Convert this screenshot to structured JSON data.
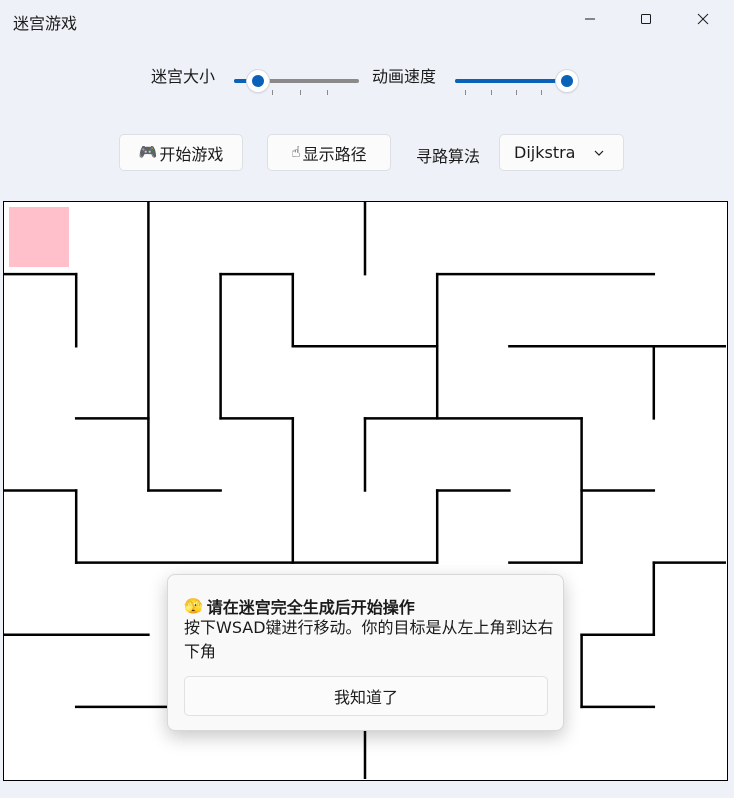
{
  "window": {
    "title": "迷宫游戏",
    "minimize_icon": "minimize-icon",
    "maximize_icon": "maximize-icon",
    "close_icon": "close-icon"
  },
  "controls": {
    "size_label": "迷宫大小",
    "size_value": 0.19,
    "speed_label": "动画速度",
    "speed_value": 1.0,
    "start_button": "开始游戏",
    "start_icon": "🎮",
    "path_button": "显示路径",
    "path_icon": "☝",
    "algo_label": "寻路算法",
    "algo_selected": "Dijkstra",
    "accent": "#0a62b8"
  },
  "maze": {
    "player_color": "#ffc0cb",
    "cols": 10,
    "rows": 8,
    "walls": [
      [
        [
          0,
          1
        ],
        [
          1,
          1
        ]
      ],
      [
        [
          1,
          1
        ],
        [
          1,
          2
        ]
      ],
      [
        [
          2,
          0
        ],
        [
          2,
          4
        ]
      ],
      [
        [
          2,
          4
        ],
        [
          3,
          4
        ]
      ],
      [
        [
          5,
          0
        ],
        [
          5,
          1
        ]
      ],
      [
        [
          3,
          1
        ],
        [
          3,
          3
        ]
      ],
      [
        [
          3,
          3
        ],
        [
          4,
          3
        ]
      ],
      [
        [
          4,
          3
        ],
        [
          4,
          5
        ]
      ],
      [
        [
          3,
          1
        ],
        [
          4,
          1
        ]
      ],
      [
        [
          4,
          1
        ],
        [
          4,
          2
        ]
      ],
      [
        [
          4,
          2
        ],
        [
          6,
          2
        ]
      ],
      [
        [
          6,
          1
        ],
        [
          9,
          1
        ]
      ],
      [
        [
          6,
          1
        ],
        [
          6,
          3
        ]
      ],
      [
        [
          7,
          2
        ],
        [
          10,
          2
        ]
      ],
      [
        [
          9,
          2
        ],
        [
          9,
          3
        ]
      ],
      [
        [
          1,
          3
        ],
        [
          2,
          3
        ]
      ],
      [
        [
          0,
          4
        ],
        [
          1,
          4
        ]
      ],
      [
        [
          1,
          4
        ],
        [
          1,
          5
        ]
      ],
      [
        [
          1,
          5
        ],
        [
          6,
          5
        ]
      ],
      [
        [
          6,
          5
        ],
        [
          6,
          4
        ]
      ],
      [
        [
          6,
          4
        ],
        [
          7,
          4
        ]
      ],
      [
        [
          5,
          3
        ],
        [
          8,
          3
        ]
      ],
      [
        [
          5,
          3
        ],
        [
          5,
          4
        ]
      ],
      [
        [
          8,
          3
        ],
        [
          8,
          5
        ]
      ],
      [
        [
          8,
          5
        ],
        [
          7,
          5
        ]
      ],
      [
        [
          8,
          4
        ],
        [
          9,
          4
        ]
      ],
      [
        [
          9,
          5
        ],
        [
          10,
          5
        ]
      ],
      [
        [
          9,
          5
        ],
        [
          9,
          6
        ]
      ],
      [
        [
          8,
          6
        ],
        [
          9,
          6
        ]
      ],
      [
        [
          8,
          6
        ],
        [
          8,
          7
        ]
      ],
      [
        [
          8,
          7
        ],
        [
          9,
          7
        ]
      ],
      [
        [
          0,
          6
        ],
        [
          2,
          6
        ]
      ],
      [
        [
          1,
          7
        ],
        [
          3,
          7
        ]
      ],
      [
        [
          5,
          7
        ],
        [
          5,
          8
        ]
      ]
    ]
  },
  "dialog": {
    "icon": "🫣",
    "title": "请在迷宫完全生成后开始操作",
    "body": "按下WSAD键进行移动。你的目标是从左上角到达右下角",
    "ok_button": "我知道了"
  }
}
